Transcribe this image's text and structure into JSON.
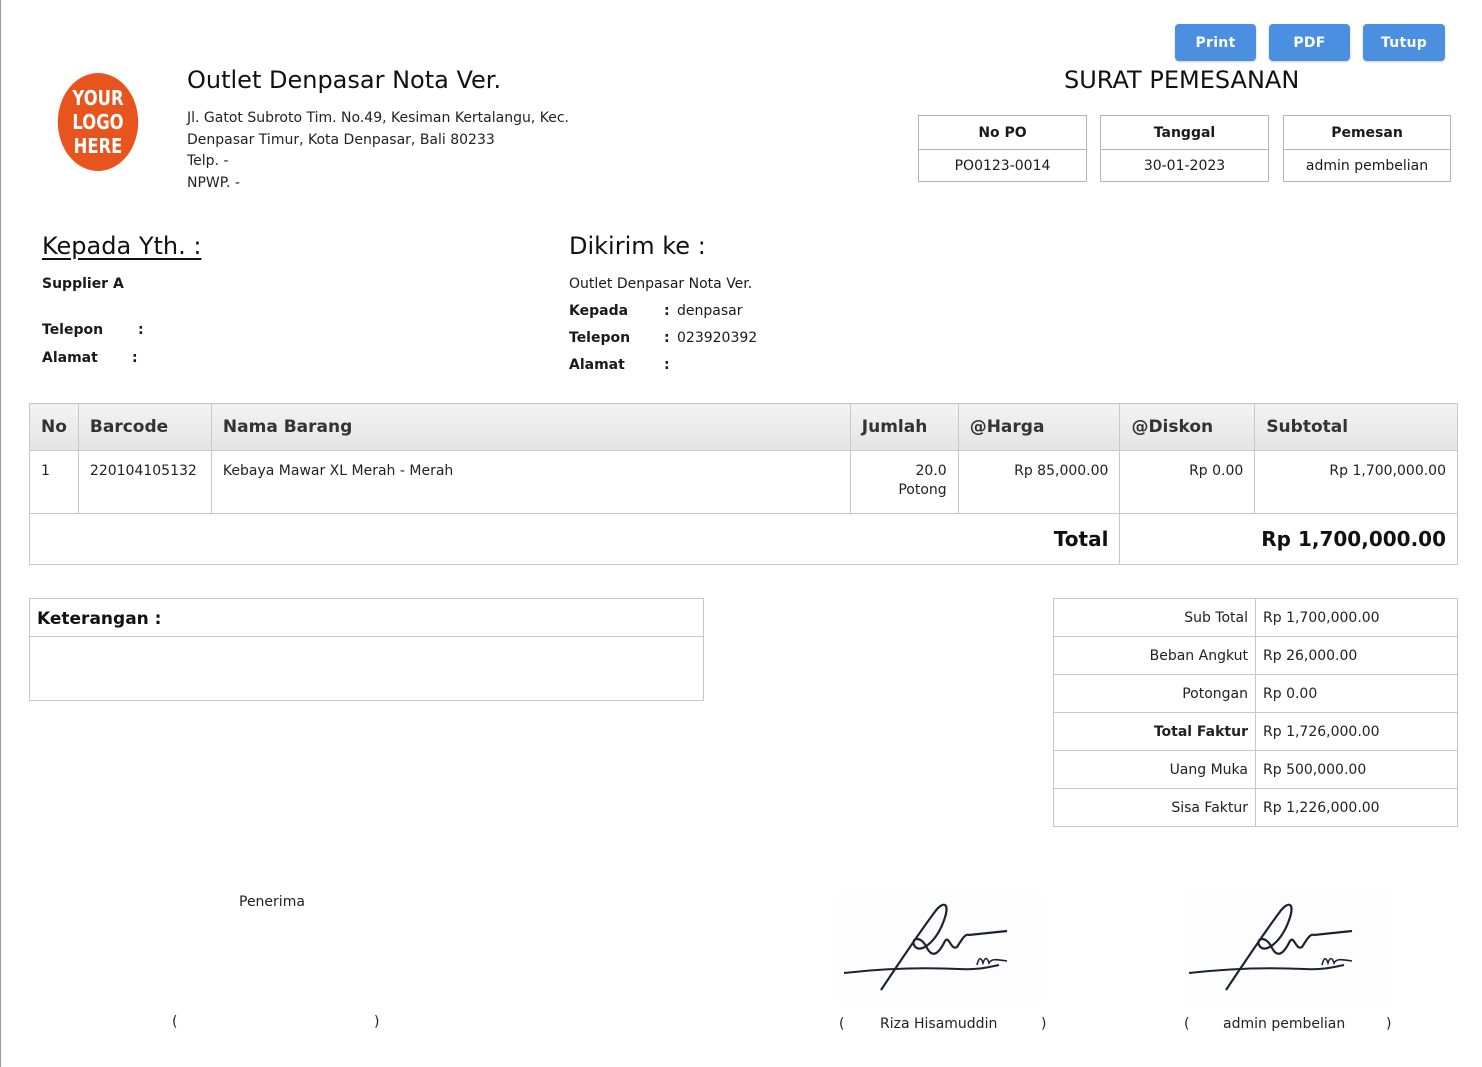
{
  "toolbar": {
    "print_label": "Print",
    "pdf_label": "PDF",
    "close_label": "Tutup"
  },
  "logo": {
    "line1": "YOUR",
    "line2": "LOGO",
    "line3": "HERE",
    "color": "#e8541e"
  },
  "company": {
    "name": "Outlet Denpasar Nota Ver.",
    "address_line1": "Jl. Gatot Subroto Tim. No.49, Kesiman Kertalangu, Kec.",
    "address_line2": "Denpasar Timur, Kota Denpasar, Bali 80233",
    "phone": "Telp. -",
    "npwp": "NPWP. -"
  },
  "document": {
    "title": "SURAT PEMESANAN",
    "po_label": "No PO",
    "po_value": "PO0123-0014",
    "date_label": "Tanggal",
    "date_value": "30-01-2023",
    "orderer_label": "Pemesan",
    "orderer_value": "admin pembelian"
  },
  "recipient": {
    "title": "Kepada Yth. :",
    "supplier": "Supplier A",
    "phone_label": "Telepon",
    "phone_value": "",
    "address_label": "Alamat",
    "address_value": ""
  },
  "shipping": {
    "title": "Dikirim ke :",
    "outlet": "Outlet Denpasar Nota Ver.",
    "to_label": "Kepada",
    "to_value": "denpasar",
    "phone_label": "Telepon",
    "phone_value": "023920392",
    "address_label": "Alamat",
    "address_value": ""
  },
  "items_table": {
    "headers": [
      "No",
      "Barcode",
      "Nama Barang",
      "Jumlah",
      "@Harga",
      "@Diskon",
      "Subtotal"
    ],
    "rows": [
      {
        "no": "1",
        "barcode": "220104105132",
        "name": "Kebaya Mawar XL Merah - Merah",
        "qty": "20.0",
        "unit": "Potong",
        "price": "Rp 85,000.00",
        "discount": "Rp 0.00",
        "subtotal": "Rp 1,700,000.00"
      }
    ],
    "total_label": "Total",
    "total_value": "Rp 1,700,000.00"
  },
  "notes": {
    "title": "Keterangan :",
    "content": ""
  },
  "summary": [
    {
      "label": "Sub Total",
      "value": "Rp 1,700,000.00",
      "bold": false
    },
    {
      "label": "Beban Angkut",
      "value": "Rp 26,000.00",
      "bold": false
    },
    {
      "label": "Potongan",
      "value": "Rp 0.00",
      "bold": false
    },
    {
      "label": "Total Faktur",
      "value": "Rp 1,726,000.00",
      "bold": true
    },
    {
      "label": "Uang Muka",
      "value": "Rp 500,000.00",
      "bold": false
    },
    {
      "label": "Sisa Faktur",
      "value": "Rp 1,226,000.00",
      "bold": false
    }
  ],
  "signatures": {
    "receiver_label": "Penerima",
    "open_paren": "(",
    "close_paren": ")",
    "signer1_name": "Riza Hisamuddin",
    "signer2_name": "admin pembelian"
  }
}
